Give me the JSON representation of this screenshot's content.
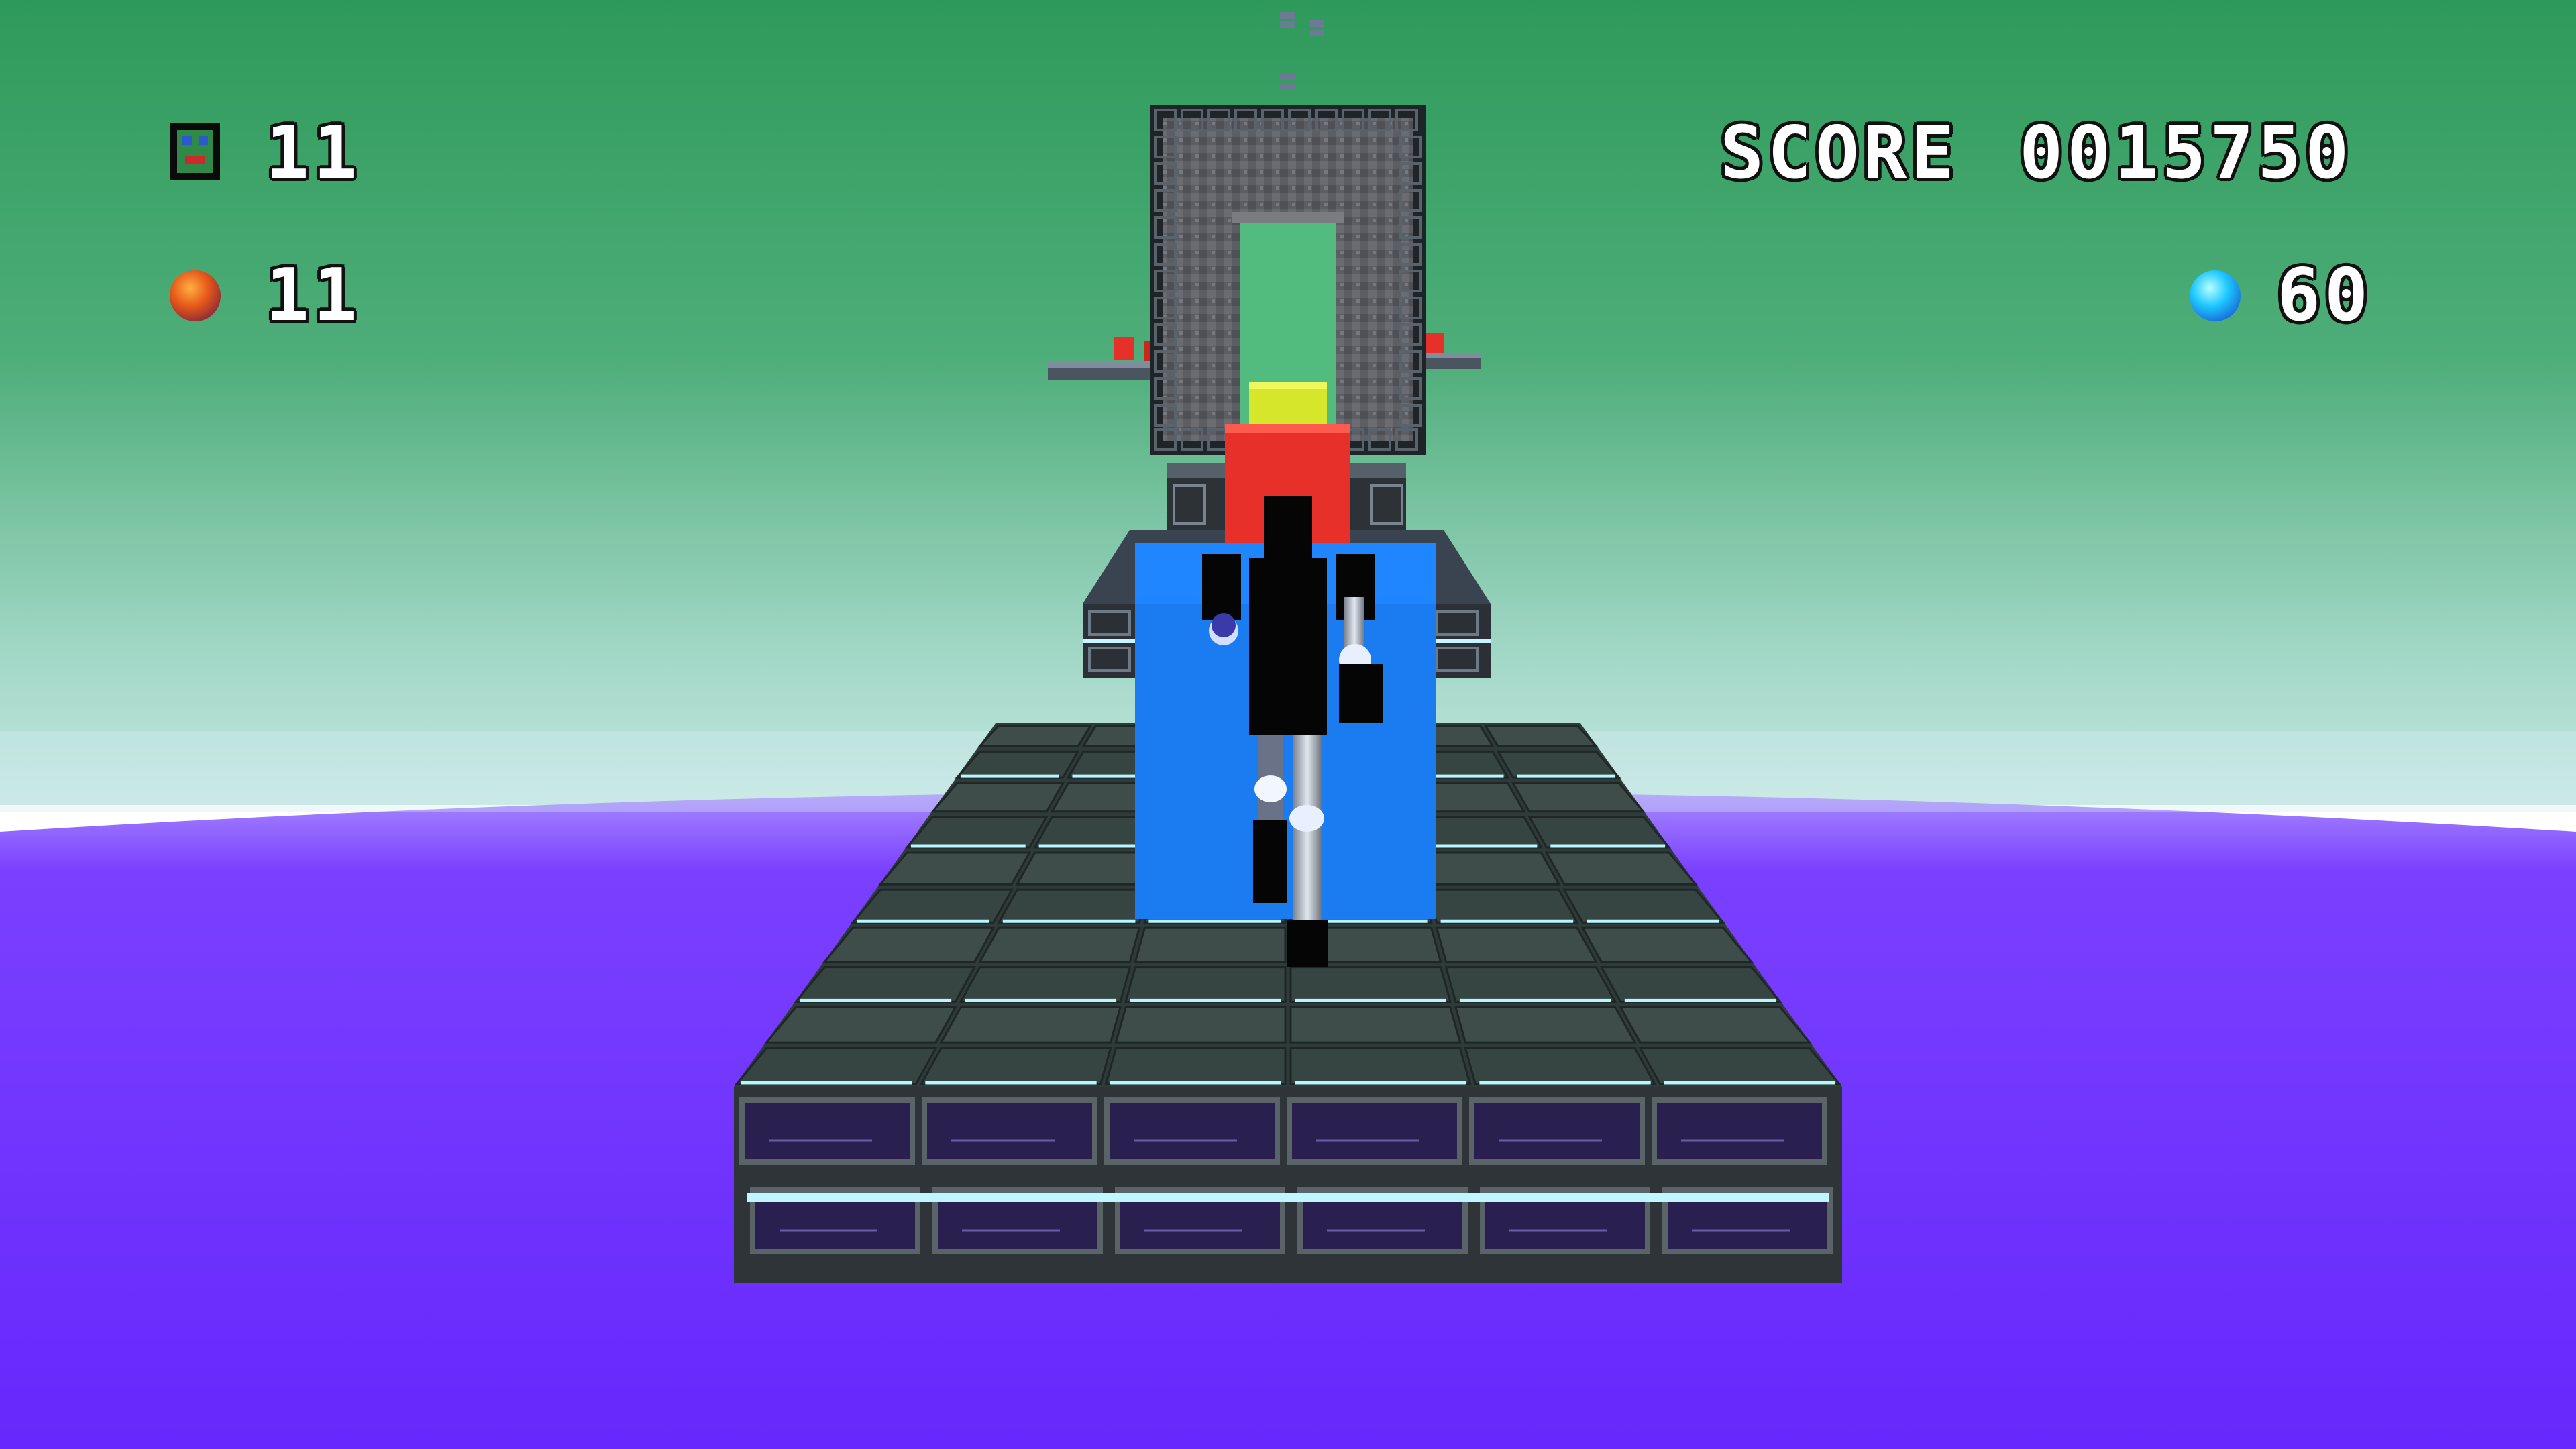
{
  "hud": {
    "lives_icon": "robot-face-icon",
    "lives": "11",
    "bombs_icon": "orange-orb-icon",
    "bombs": "11",
    "score_label": "SCORE",
    "score_value": "0015750",
    "gems_icon": "cyan-orb-icon",
    "gems": "60"
  },
  "colors": {
    "sky_top": "#2e9a5a",
    "sky_horizon": "#b6e2dc",
    "void": "#6a2cff",
    "player_body": "#000000",
    "block_blue": "#1a7cf0",
    "block_red": "#e8302a",
    "block_yellow": "#d6e62a",
    "tile_dark": "#3c4a48",
    "tile_glow": "#9ef4ff"
  }
}
